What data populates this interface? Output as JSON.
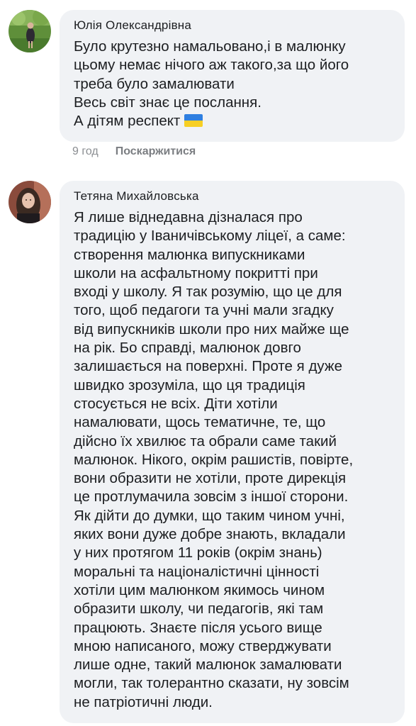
{
  "comments": [
    {
      "author": "Юлія Олександрівна",
      "text": "Було крутезно намальовано,і в малюнку\nцьому немає нічого аж такого,за що його\nтреба було замалювати\nВесь світ знає це послання.\nА дітям респект",
      "flag_icon": "ukraine-flag-icon",
      "time": "9 год",
      "report_label": "Поскаржитися"
    },
    {
      "author": "Тетяна Михайловська",
      "text": "Я лише віднедавна дізналася про\nтрадицію у Іваничівському ліцеї, а саме:\nстворення малюнка випускниками\nшколи на асфальтному покритті при\nвході у школу. Я так розумію, що це для\nтого, щоб педагоги та учні мали згадку\nвід випускників школи про них майже ще\nна рік. Бо справді, малюнок довго\nзалишається на поверхні. Проте я дуже\nшвидко зрозуміла, що ця традиція\nстосується не всіх. Діти хотіли\nнамалювати, щось тематичне, те, що\nдійсно їх хвилює та обрали саме такий\nмалюнок. Нікого, окрім рашистів, повірте,\nвони образити не хотіли, проте дирекція\nце протлумачила зовсім з іншої сторони.\nЯк дійти до думки, що таким чином учні,\nяких вони дуже добре знають, вкладали\nу них протягом 11 років (окрім знань)\nморальні та націоналістичні цінності\nхотіли цим малюнком якимось чином\nобразити школу, чи педагогів, які там\nпрацюють. Знаєте після усього вище\nмною написаного, можу стверджувати\nлише одне, такий малюнок замалювати\nмогли, так толерантно сказати, ну зовсім\nне патріотичні люди."
    }
  ],
  "colors": {
    "bubble": "#f0f2f5",
    "meta_text": "#8a8d91",
    "flag_blue": "#2f7fe0",
    "flag_yellow": "#f7cf24"
  }
}
